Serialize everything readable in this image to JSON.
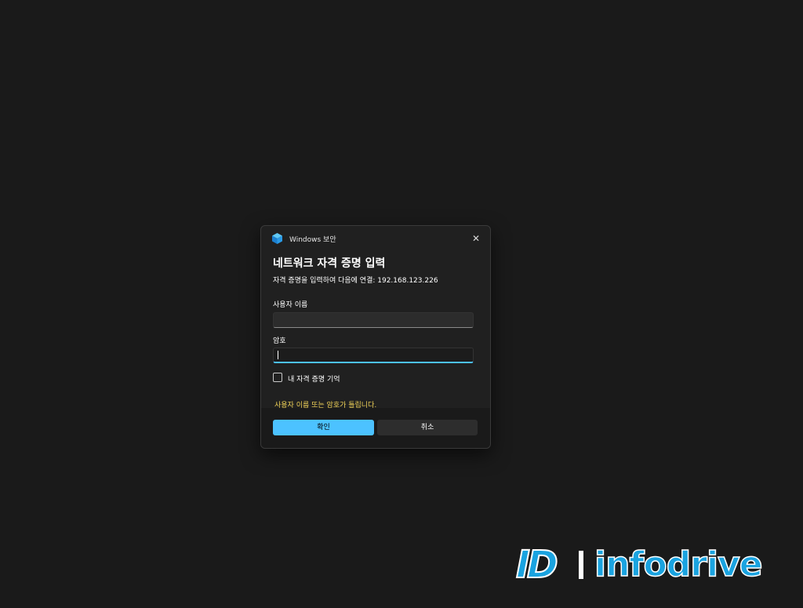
{
  "dialog": {
    "window_title": "Windows 보안",
    "close_symbol": "✕",
    "heading": "네트워크 자격 증명 입력",
    "subtext": "자격 증명을 입력하여 다음에 연결: 192.168.123.226",
    "username_label": "사용자 이름",
    "username_value": "",
    "password_label": "암호",
    "password_value": "",
    "remember_label": "내 자격 증명 기억",
    "remember_checked": false,
    "error_message": "사용자 이름 또는 암호가 틀립니다.",
    "ok_label": "확인",
    "cancel_label": "취소",
    "icon": "shield-icon"
  },
  "watermark": {
    "mark": "ID",
    "text": "infodrive"
  },
  "colors": {
    "accent": "#4cc2ff",
    "error": "#f0d257",
    "background": "#1a1a1a",
    "dialog": "#202020"
  }
}
